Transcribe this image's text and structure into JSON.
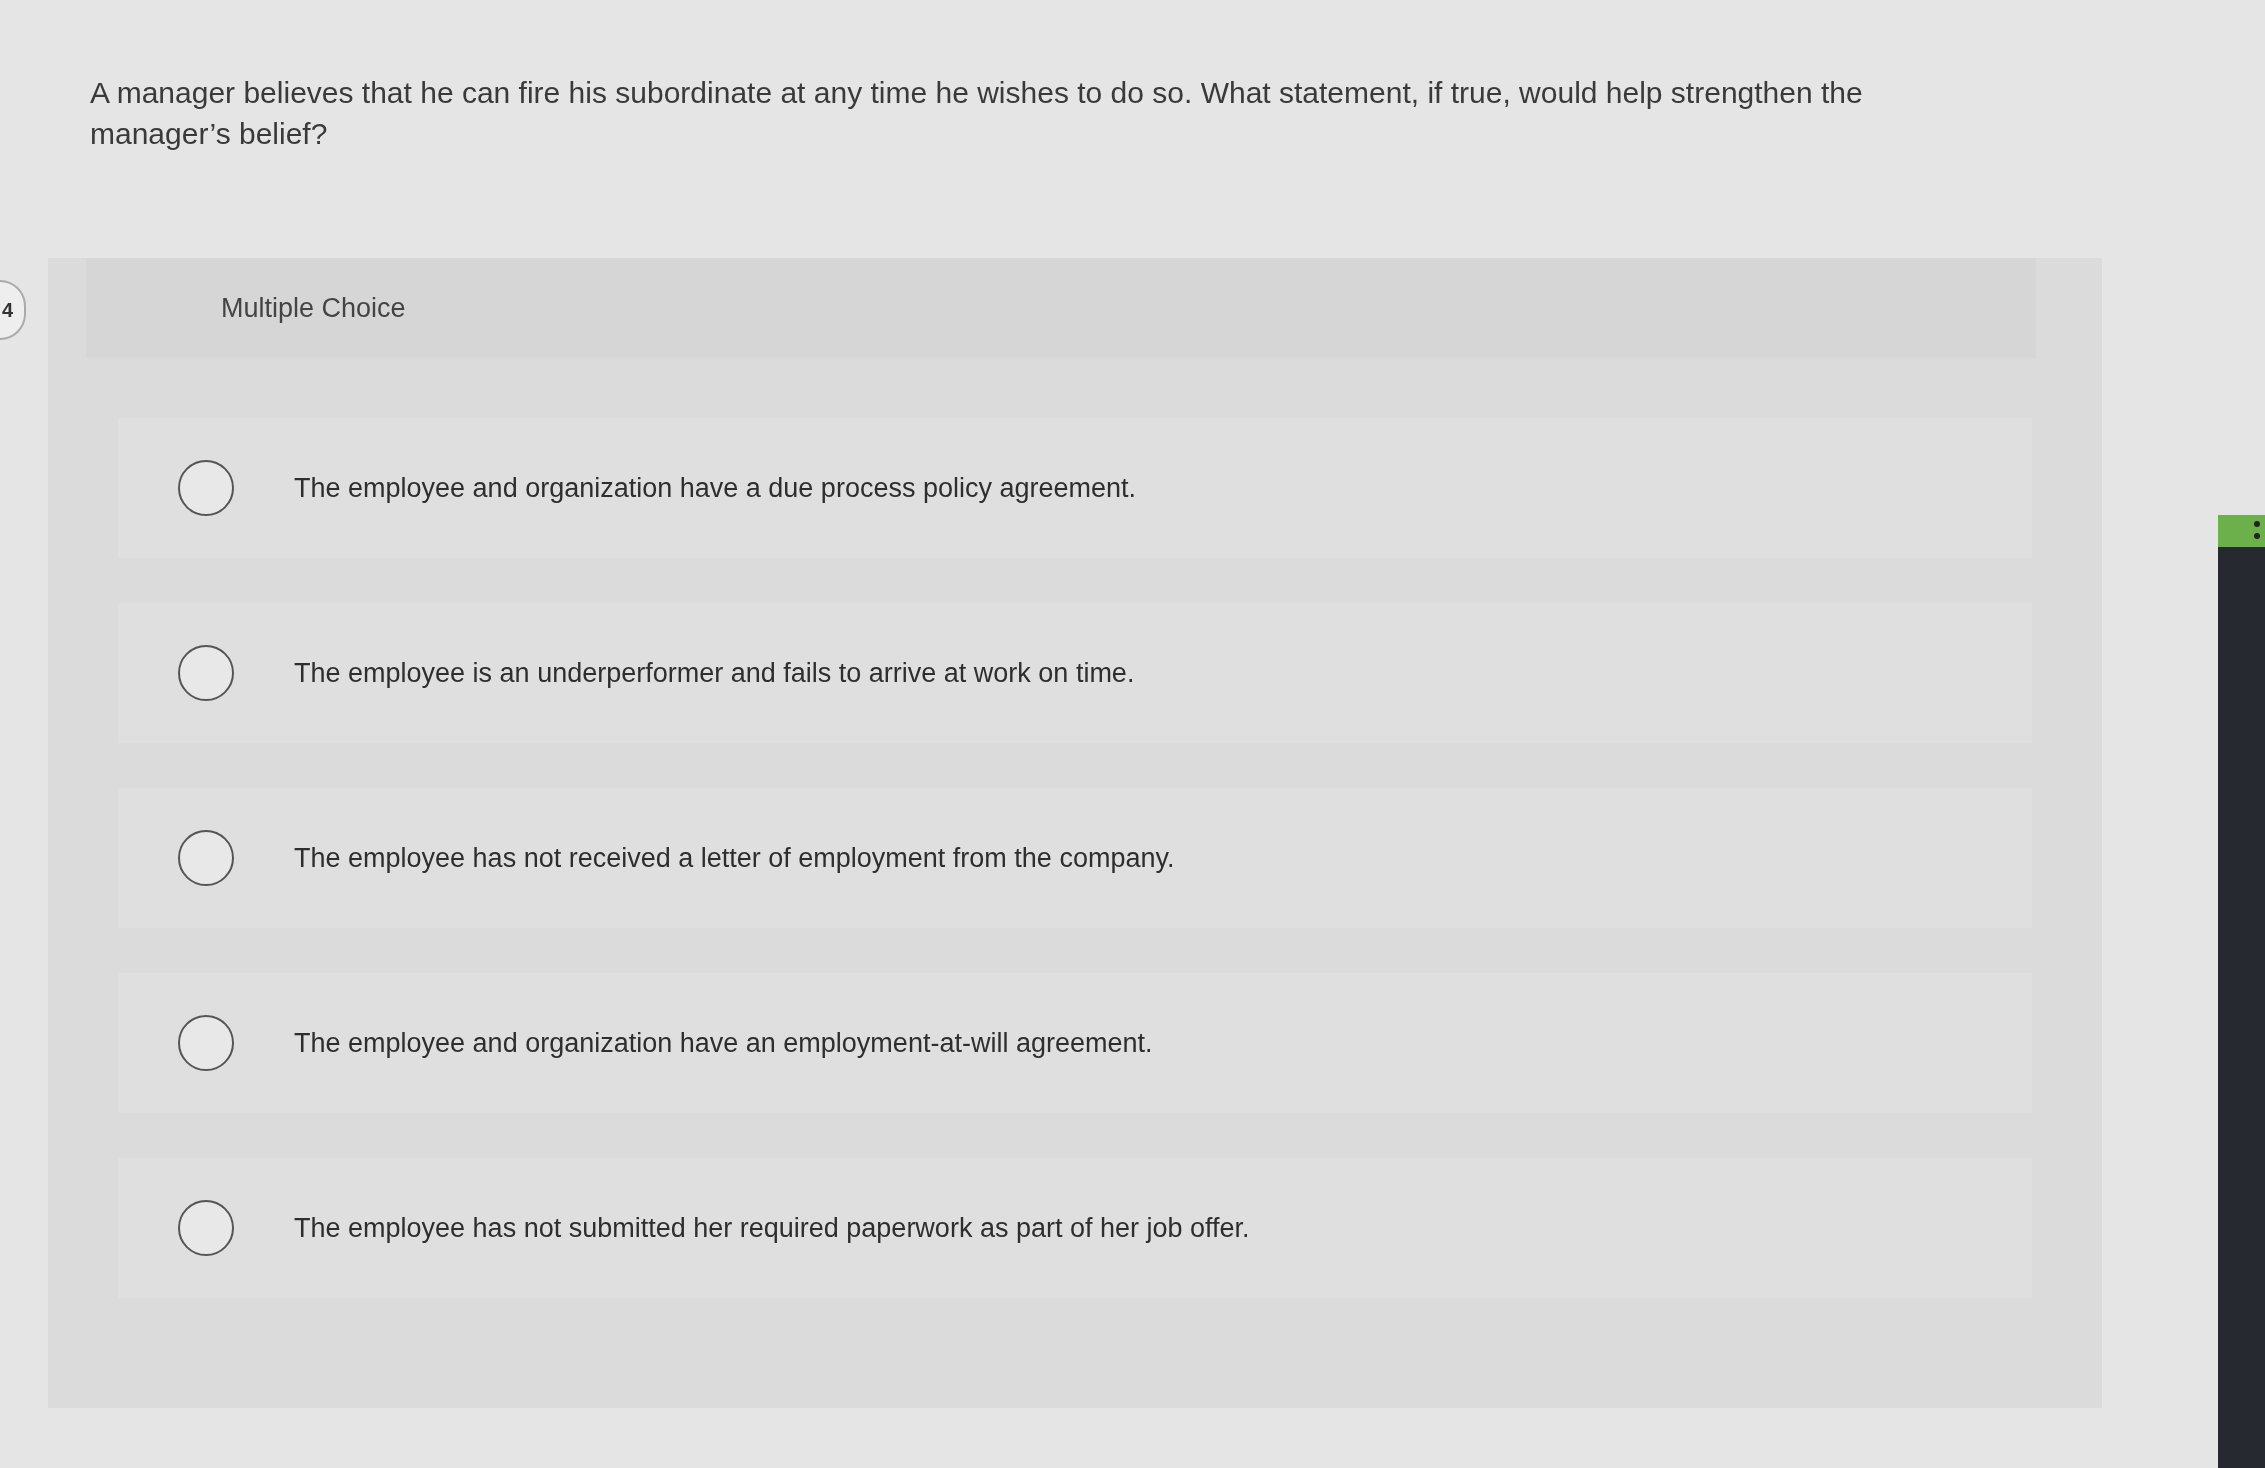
{
  "question_number": "4",
  "question": "A manager believes that he can fire his subordinate at any time he wishes to do so. What statement, if true, would help strengthen the manager’s belief?",
  "answer_panel": {
    "label": "Multiple Choice",
    "options": [
      {
        "text": "The employee and organization have a due process policy agreement.",
        "selected": false
      },
      {
        "text": "The employee is an underperformer and fails to arrive at work on time.",
        "selected": false
      },
      {
        "text": "The employee has not received a letter of employment from the company.",
        "selected": false
      },
      {
        "text": "The employee and organization have an employment-at-will agreement.",
        "selected": false
      },
      {
        "text": "The employee has not submitted her required paperwork as part of her job offer.",
        "selected": false
      }
    ]
  }
}
